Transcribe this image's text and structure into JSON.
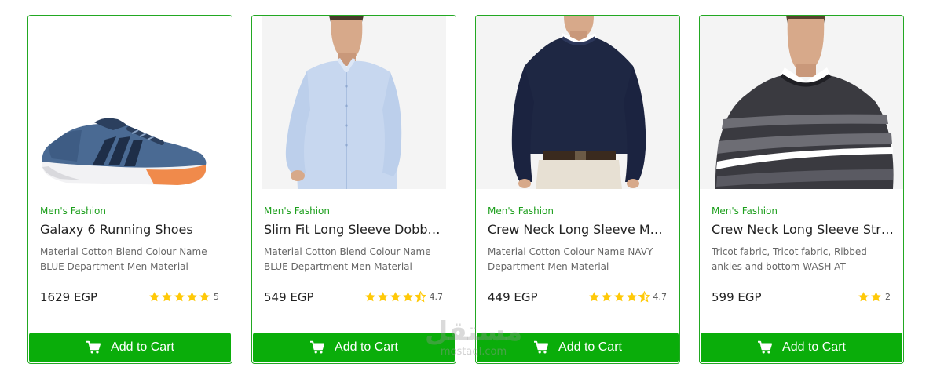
{
  "products": [
    {
      "category": "Men's Fashion",
      "title": "Galaxy 6 Running Shoes",
      "description": "Material Cotton Blend Colour Name BLUE Department Men Material",
      "price": "1629 EGP",
      "rating": 5,
      "rating_label": "5",
      "image": "running-shoe",
      "cta": "Add to Cart"
    },
    {
      "category": "Men's Fashion",
      "title": "Slim Fit Long Sleeve Dobby Shirt",
      "description": "Material Cotton Blend Colour Name BLUE Department Men Material",
      "price": "549 EGP",
      "rating": 4.7,
      "rating_label": "4.7",
      "image": "light-blue-shirt",
      "cta": "Add to Cart"
    },
    {
      "category": "Men's Fashion",
      "title": "Crew Neck Long Sleeve Men Sweater",
      "description": "Material Cotton Colour Name NAVY Department Men Material",
      "price": "449 EGP",
      "rating": 4.7,
      "rating_label": "4.7",
      "image": "navy-sweater",
      "cta": "Add to Cart"
    },
    {
      "category": "Men's Fashion",
      "title": "Crew Neck Long Sleeve Striped Sweater",
      "description": "Tricot fabric, Tricot fabric, Ribbed ankles and bottom WASH AT",
      "price": "599 EGP",
      "rating": 2,
      "rating_label": "2",
      "image": "striped-sweater",
      "cta": "Add to Cart"
    }
  ],
  "watermark": {
    "arabic": "مستقل",
    "latin": "mostaql.com"
  },
  "colors": {
    "accent": "#0aad0a",
    "category": "#1d9f1d",
    "star": "#ffc908"
  }
}
